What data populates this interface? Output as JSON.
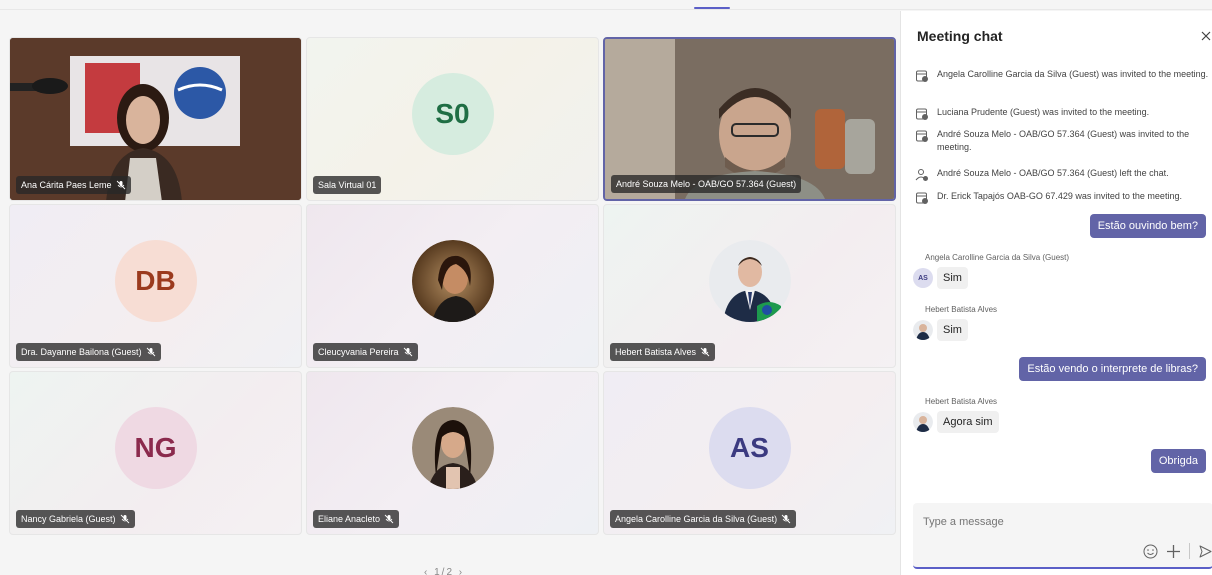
{
  "stage": {
    "pager": "‹ 1/2 ›",
    "tiles": [
      {
        "name": "Ana Cárita Paes Leme",
        "muted": true,
        "type": "video"
      },
      {
        "name": "Sala Virtual 01",
        "initials": "S0",
        "muted": false,
        "type": "initials",
        "avatar_bg": "#d6ecdf",
        "avatar_fg": "#1f6e44"
      },
      {
        "name": "André Souza Melo - OAB/GO 57.364 (Guest)",
        "muted": false,
        "type": "video",
        "speaking": true
      },
      {
        "name": "Dra. Dayanne Bailona (Guest)",
        "initials": "DB",
        "muted": true,
        "type": "initials",
        "avatar_bg": "#f7ddd4",
        "avatar_fg": "#9b3a1e"
      },
      {
        "name": "Cleucyvania Pereira",
        "muted": true,
        "type": "photo"
      },
      {
        "name": "Hebert Batista Alves",
        "muted": true,
        "type": "photo"
      },
      {
        "name": "Nancy Gabriela (Guest)",
        "initials": "NG",
        "muted": true,
        "type": "initials",
        "avatar_bg": "#efd9e3",
        "avatar_fg": "#8b2a4d"
      },
      {
        "name": "Eliane Anacleto",
        "muted": true,
        "type": "photo"
      },
      {
        "name": "Angela Carolline Garcia da Silva (Guest)",
        "initials": "AS",
        "muted": true,
        "type": "initials",
        "avatar_bg": "#dcdcef",
        "avatar_fg": "#3b3a80"
      }
    ]
  },
  "chat": {
    "title": "Meeting chat",
    "system_messages": [
      "Angela Carolline Garcia da Silva (Guest) was invited to the meeting.",
      "Luciana Prudente (Guest) was invited to the meeting.",
      "André Souza Melo - OAB/GO 57.364 (Guest) was invited to the meeting.",
      "André Souza Melo - OAB/GO 57.364 (Guest) left the chat.",
      "Dr. Erick Tapajós OAB-GO 67.429 was invited to the meeting."
    ],
    "messages": [
      {
        "from": "me",
        "text": "Estão ouvindo bem?"
      },
      {
        "from": "Angela Carolline Garcia da Silva (Guest)",
        "initials": "AS",
        "text": "Sim"
      },
      {
        "from": "Hebert Batista Alves",
        "text": "Sim"
      },
      {
        "from": "me",
        "text": "Estão vendo o interprete de libras?"
      },
      {
        "from": "Hebert Batista Alves",
        "text": "Agora sim"
      },
      {
        "from": "me",
        "text": "Obrigda"
      }
    ],
    "composer_placeholder": "Type a message",
    "accent": "#6264a7"
  }
}
